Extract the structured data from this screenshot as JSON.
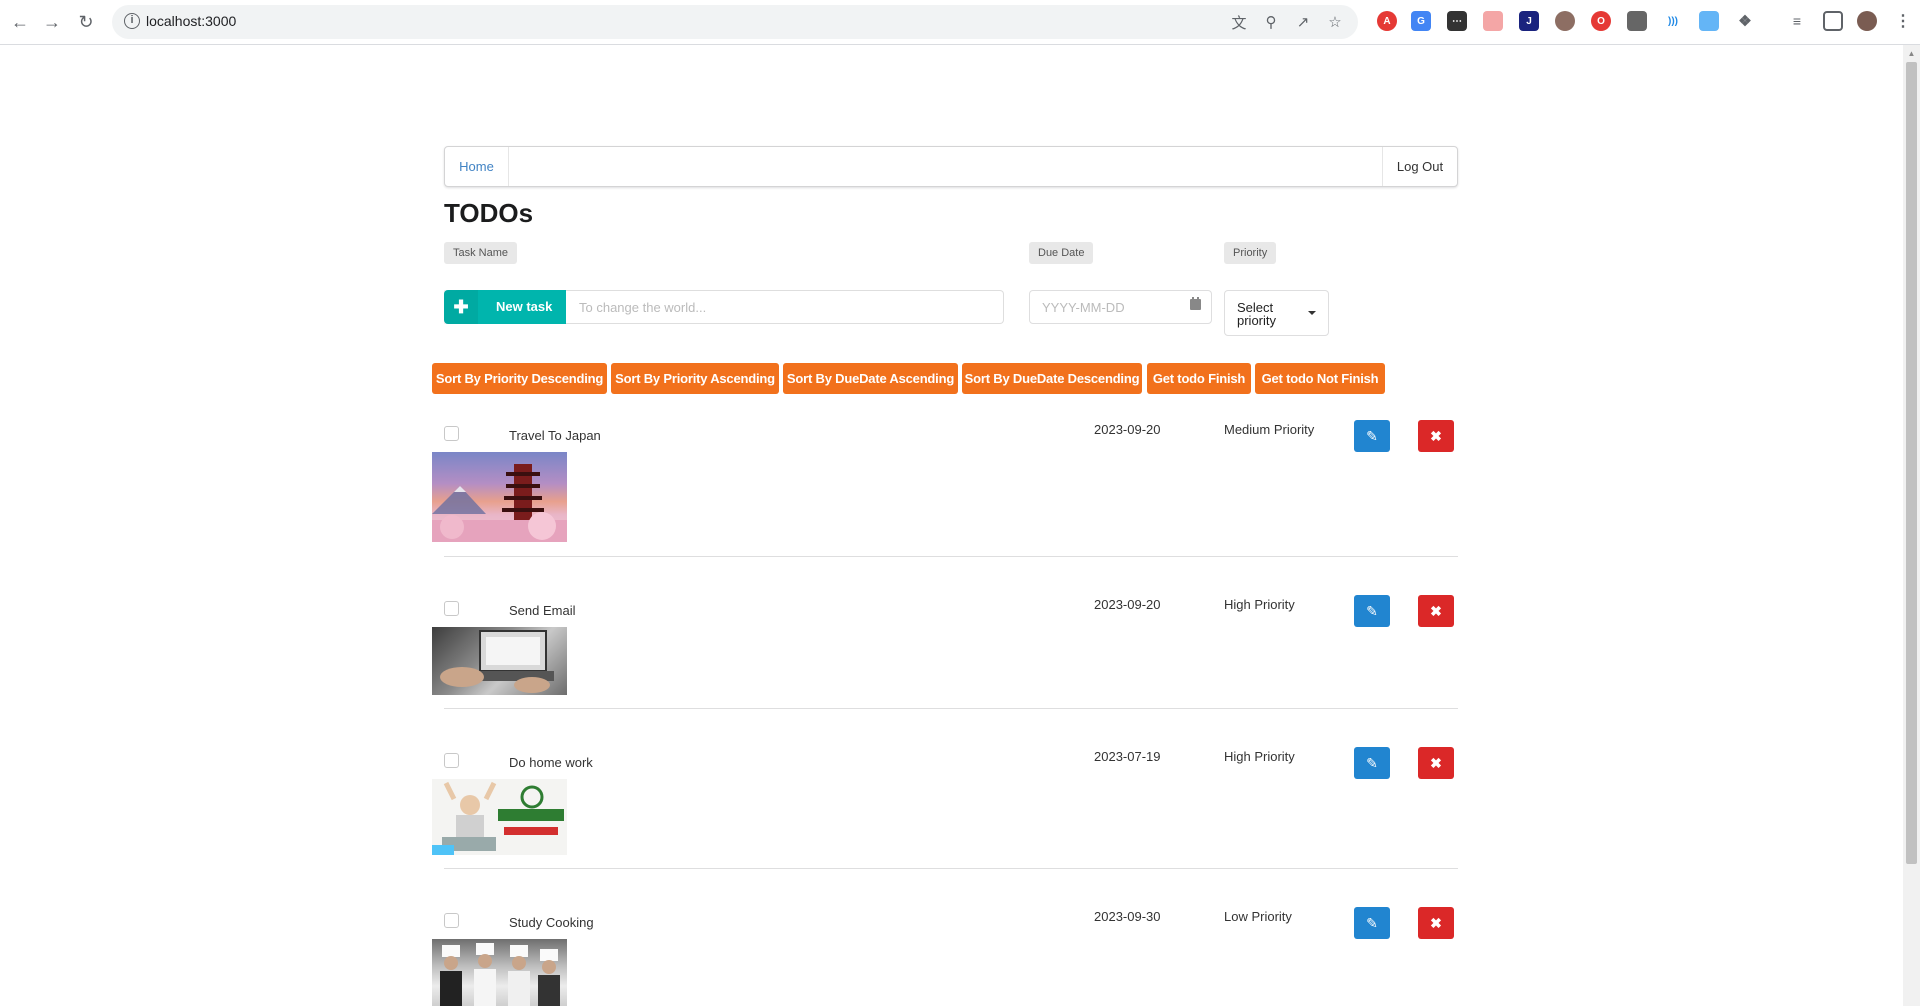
{
  "browser": {
    "url": "localhost:3000",
    "accent": "#5f6368"
  },
  "nav": {
    "home": "Home",
    "logout": "Log Out"
  },
  "page": {
    "title": "TODOs"
  },
  "form": {
    "task_name_label": "Task Name",
    "due_date_label": "Due Date",
    "priority_label": "Priority",
    "new_task_label": "New task",
    "task_placeholder": "To change the world...",
    "date_placeholder": "YYYY-MM-DD",
    "priority_placeholder": "Select priority"
  },
  "sort_buttons": [
    "Sort By Priority Descending",
    "Sort By Priority Ascending",
    "Sort By DueDate Ascending",
    "Sort By DueDate Descending",
    "Get todo Finish",
    "Get todo Not Finish"
  ],
  "todos": [
    {
      "name": "Travel To Japan",
      "due": "2023-09-20",
      "priority": "Medium Priority",
      "image": "japan-pagoda"
    },
    {
      "name": "Send Email",
      "due": "2023-09-20",
      "priority": "High Priority",
      "image": "laptop-typing"
    },
    {
      "name": "Do home work",
      "due": "2023-07-19",
      "priority": "High Priority",
      "image": "homework-banner"
    },
    {
      "name": "Study Cooking",
      "due": "2023-09-30",
      "priority": "Low Priority",
      "image": "chefs-kitchen"
    }
  ],
  "colors": {
    "teal": "#00b5ad",
    "orange": "#f2711c",
    "blue": "#2185d0",
    "red": "#db2828",
    "link": "#4183c4"
  },
  "icons": {
    "edit": "pencil-icon",
    "delete": "close-icon",
    "add": "plus-icon",
    "calendar": "calendar-icon"
  }
}
